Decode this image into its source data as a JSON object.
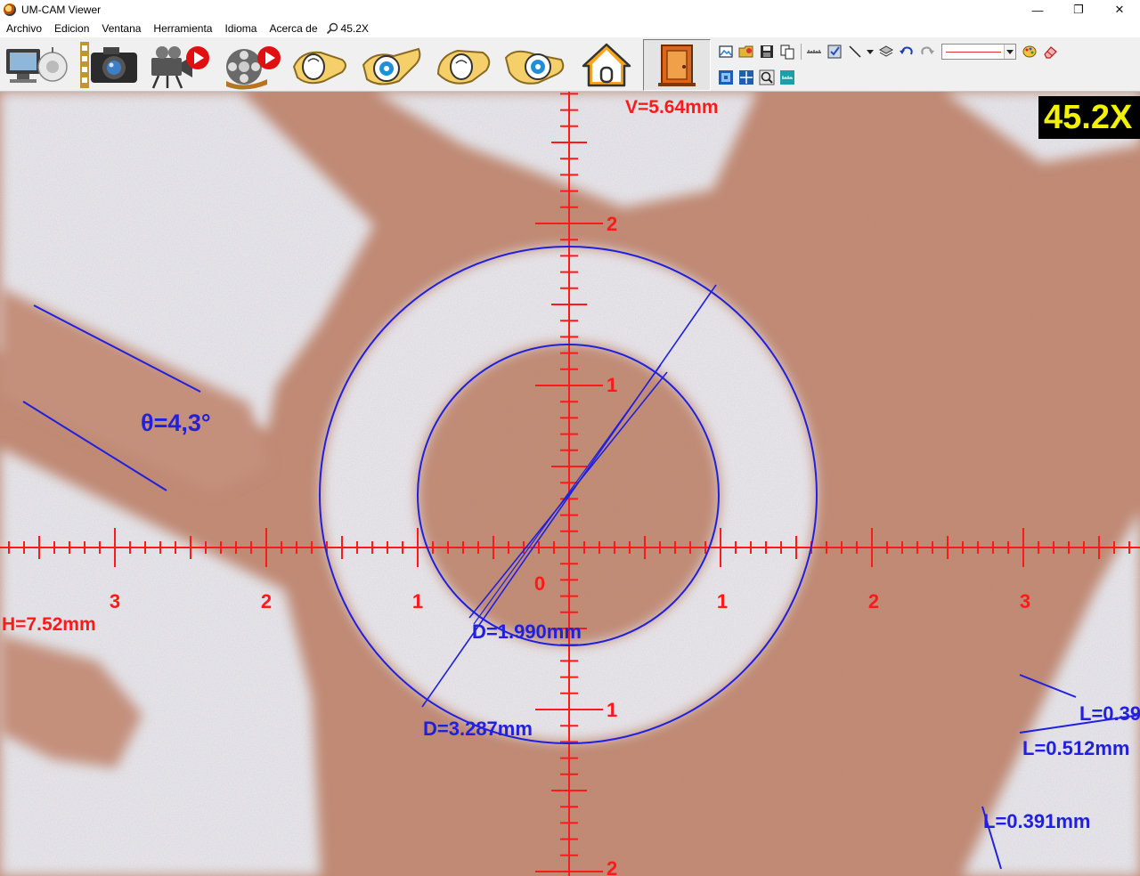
{
  "window": {
    "title": "UM-CAM Viewer",
    "controls": {
      "minimize": "—",
      "restore": "❐",
      "close": "✕"
    }
  },
  "menu": {
    "items": [
      "Archivo",
      "Edicion",
      "Ventana",
      "Herramienta",
      "Idioma",
      "Acerca de"
    ],
    "zoom_readout": "45.2X"
  },
  "toolbar": {
    "big_buttons": [
      {
        "icon": "device-icon"
      },
      {
        "icon": "camera-icon"
      },
      {
        "icon": "video-record-icon"
      },
      {
        "icon": "film-play-icon"
      },
      {
        "icon": "hand-icon"
      },
      {
        "icon": "hand-lens-icon"
      },
      {
        "icon": "hand-icon"
      },
      {
        "icon": "hand-lens-icon"
      },
      {
        "icon": "home-icon"
      },
      {
        "icon": "exit-door-icon"
      }
    ],
    "line_style_color": "#e03030"
  },
  "viewer": {
    "zoom_badge": "45.2X",
    "reticle_color": "#ff1a1a",
    "measure_color": "#2020dd",
    "horizontal_ticks": {
      "left": [
        "3",
        "2",
        "1"
      ],
      "origin": "0",
      "right": [
        "1",
        "2",
        "3"
      ]
    },
    "vertical_ticks": {
      "up": [
        "2",
        "1"
      ],
      "down": [
        "1",
        "2"
      ]
    },
    "readouts": {
      "vertical": "V=5.64mm",
      "horizontal": "H=7.52mm"
    },
    "measurements": {
      "angle": "θ=4,3°",
      "inner_diameter": "D=1.990mm",
      "outer_diameter": "D=3.287mm",
      "length_1": "L=0.39",
      "length_2": "L=0.512mm",
      "length_3": "L=0.391mm"
    }
  }
}
